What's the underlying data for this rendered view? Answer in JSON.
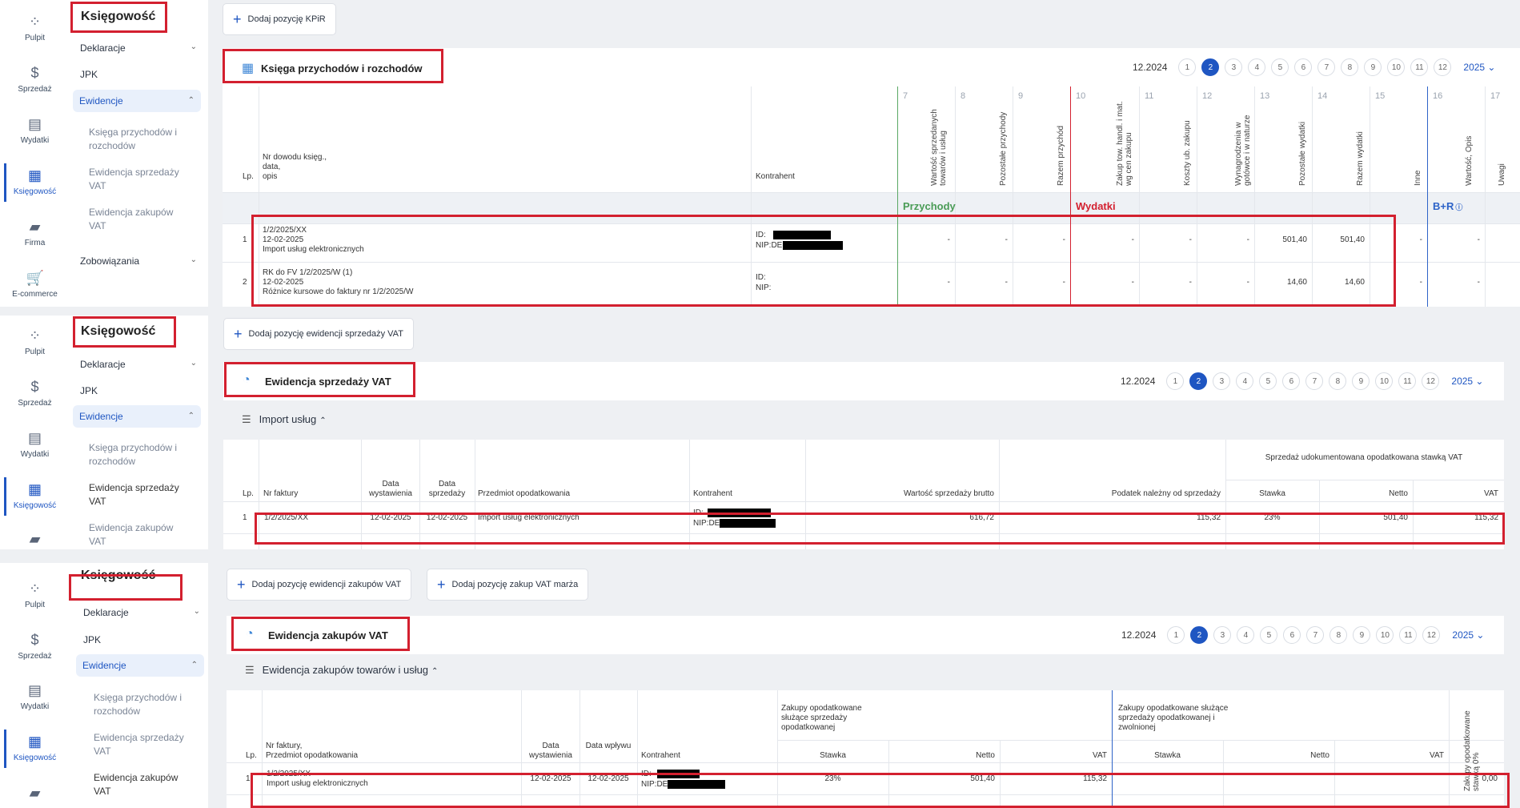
{
  "rail": {
    "pulpit": "Pulpit",
    "sprzedaz": "Sprzedaż",
    "wydatki": "Wydatki",
    "ksiegowosc": "Księgowość",
    "firma": "Firma",
    "ecommerce": "E-commerce"
  },
  "sidebar": {
    "title": "Księgowość",
    "deklaracje": "Deklaracje",
    "jpk": "JPK",
    "ewidencje": "Ewidencje",
    "kpir": "Księga przychodów i rozchodów",
    "sprzedaz_vat": "Ewidencja sprzedaży VAT",
    "zakupy_vat": "Ewidencja zakupów VAT",
    "zobowiazania": "Zobowiązania"
  },
  "pager": {
    "month": "12.2024",
    "pages": [
      "1",
      "2",
      "3",
      "4",
      "5",
      "6",
      "7",
      "8",
      "9",
      "10",
      "11",
      "12"
    ],
    "year": "2025 ⌄"
  },
  "kpir": {
    "add_button": "Dodaj pozycję KPiR",
    "title": "Księga przychodów i rozchodów",
    "col_lp": "Lp.",
    "col_nr": "Nr dowodu księg.,",
    "col_nr2": "data,",
    "col_nr3": "opis",
    "col_kontrahent": "Kontrahent",
    "nums": [
      "7",
      "8",
      "9",
      "10",
      "11",
      "12",
      "13",
      "14",
      "15",
      "16",
      "17"
    ],
    "rot": [
      "Wartość sprzedanych towarów i usług",
      "Pozostałe przychody",
      "Razem przychód",
      "Zakup tow. handl. i mat. wg cen zakupu",
      "Koszty ub. zakupu",
      "Wynagrodzenia w gotówce i w naturze",
      "Pozostałe wydatki",
      "Razem wydatki",
      "Inne",
      "Wartość, Opis",
      "Uwagi"
    ],
    "przychody": "Przychody",
    "wydatki": "Wydatki",
    "br": "B+R",
    "rows": [
      {
        "lp": "1",
        "l1": "1/2/2025/XX",
        "l2": "12-02-2025",
        "l3": "Import usług elektronicznych",
        "id": "ID:",
        "nip": "NIP:DE",
        "v13": "501,40",
        "v14": "501,40"
      },
      {
        "lp": "2",
        "l1": "RK do FV 1/2/2025/W (1)",
        "l2": "12-02-2025",
        "l3": "Różnice kursowe do faktury nr 1/2/2025/W",
        "id": "ID:",
        "nip": "NIP:",
        "v13": "14,60",
        "v14": "14,60"
      }
    ],
    "dash": "-"
  },
  "sales": {
    "add_button": "Dodaj pozycję ewidencji sprzedaży VAT",
    "title": "Ewidencja sprzedaży VAT",
    "section": "Import usług",
    "group": "Sprzedaż udokumentowana opodatkowana stawką VAT",
    "cols": {
      "lp": "Lp.",
      "nr": "Nr faktury",
      "dw": "Data wystawienia",
      "ds": "Data sprzedaży",
      "po": "Przedmiot opodatkowania",
      "k": "Kontrahent",
      "wb": "Wartość sprzedaży brutto",
      "pn": "Podatek należny od sprzedaży",
      "st": "Stawka",
      "netto": "Netto",
      "vat": "VAT"
    },
    "row": {
      "lp": "1",
      "nr": "1/2/2025/XX",
      "dw": "12-02-2025",
      "ds": "12-02-2025",
      "po": "Import usług elektronicznych",
      "id": "ID:",
      "nip": "NIP:DE",
      "wb": "616,72",
      "pn": "115,32",
      "st": "23%",
      "netto": "501,40",
      "vat": "115,32"
    }
  },
  "purchases": {
    "add_button": "Dodaj pozycję ewidencji zakupów VAT",
    "add_button2": "Dodaj pozycję zakup VAT marża",
    "title": "Ewidencja zakupów VAT",
    "section": "Ewidencja zakupów towarów i usług",
    "group1": "Zakupy opodatkowane służące sprzedaży opodatkowanej",
    "group2": "Zakupy opodatkowane służące sprzedaży opodatkowanej i zwolnionej",
    "rot0": "Zakupy opodatkowane stawką 0%",
    "cols": {
      "lp": "Lp.",
      "nr": "Nr faktury,",
      "nr2": "Przedmiot opodatkowania",
      "dw": "Data wystawienia",
      "dwp": "Data wpływu",
      "k": "Kontrahent",
      "st": "Stawka",
      "netto": "Netto",
      "vat": "VAT"
    },
    "row": {
      "lp": "1",
      "nr": "1/2/2025/XX",
      "po": "Import usług elektronicznych",
      "dw": "12-02-2025",
      "dwp": "12-02-2025",
      "id": "ID:",
      "nip": "NIP:DE",
      "st": "23%",
      "netto": "501,40",
      "vat": "115,32",
      "zero": "0,00"
    }
  }
}
